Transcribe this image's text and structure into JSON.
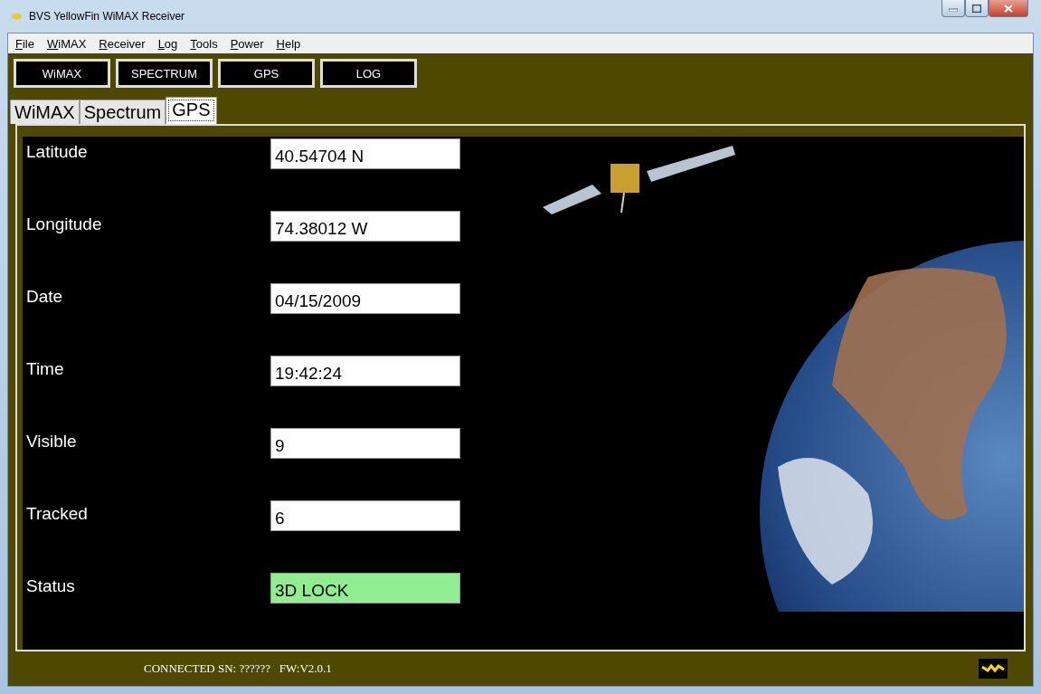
{
  "window": {
    "title": "BVS YellowFin WiMAX Receiver"
  },
  "menu": [
    "File",
    "WiMAX",
    "Receiver",
    "Log",
    "Tools",
    "Power",
    "Help"
  ],
  "toolbar": [
    "WiMAX",
    "SPECTRUM",
    "GPS",
    "LOG"
  ],
  "tabs": [
    {
      "label": "WiMAX",
      "selected": false
    },
    {
      "label": "Spectrum",
      "selected": false
    },
    {
      "label": "GPS",
      "selected": true
    }
  ],
  "fields": [
    {
      "label": "Latitude",
      "value": "40.54704 N",
      "highlighted": false
    },
    {
      "label": "Longitude",
      "value": "74.38012 W",
      "highlighted": false
    },
    {
      "label": "Date",
      "value": "04/15/2009",
      "highlighted": false
    },
    {
      "label": "Time",
      "value": "19:42:24",
      "highlighted": false
    },
    {
      "label": "Visible",
      "value": "9",
      "highlighted": false
    },
    {
      "label": "Tracked",
      "value": "6",
      "highlighted": false
    },
    {
      "label": "Status",
      "value": "3D LOCK",
      "highlighted": true
    }
  ],
  "status_bar": {
    "text": "CONNECTED SN: ??????   FW:V2.0.1"
  }
}
